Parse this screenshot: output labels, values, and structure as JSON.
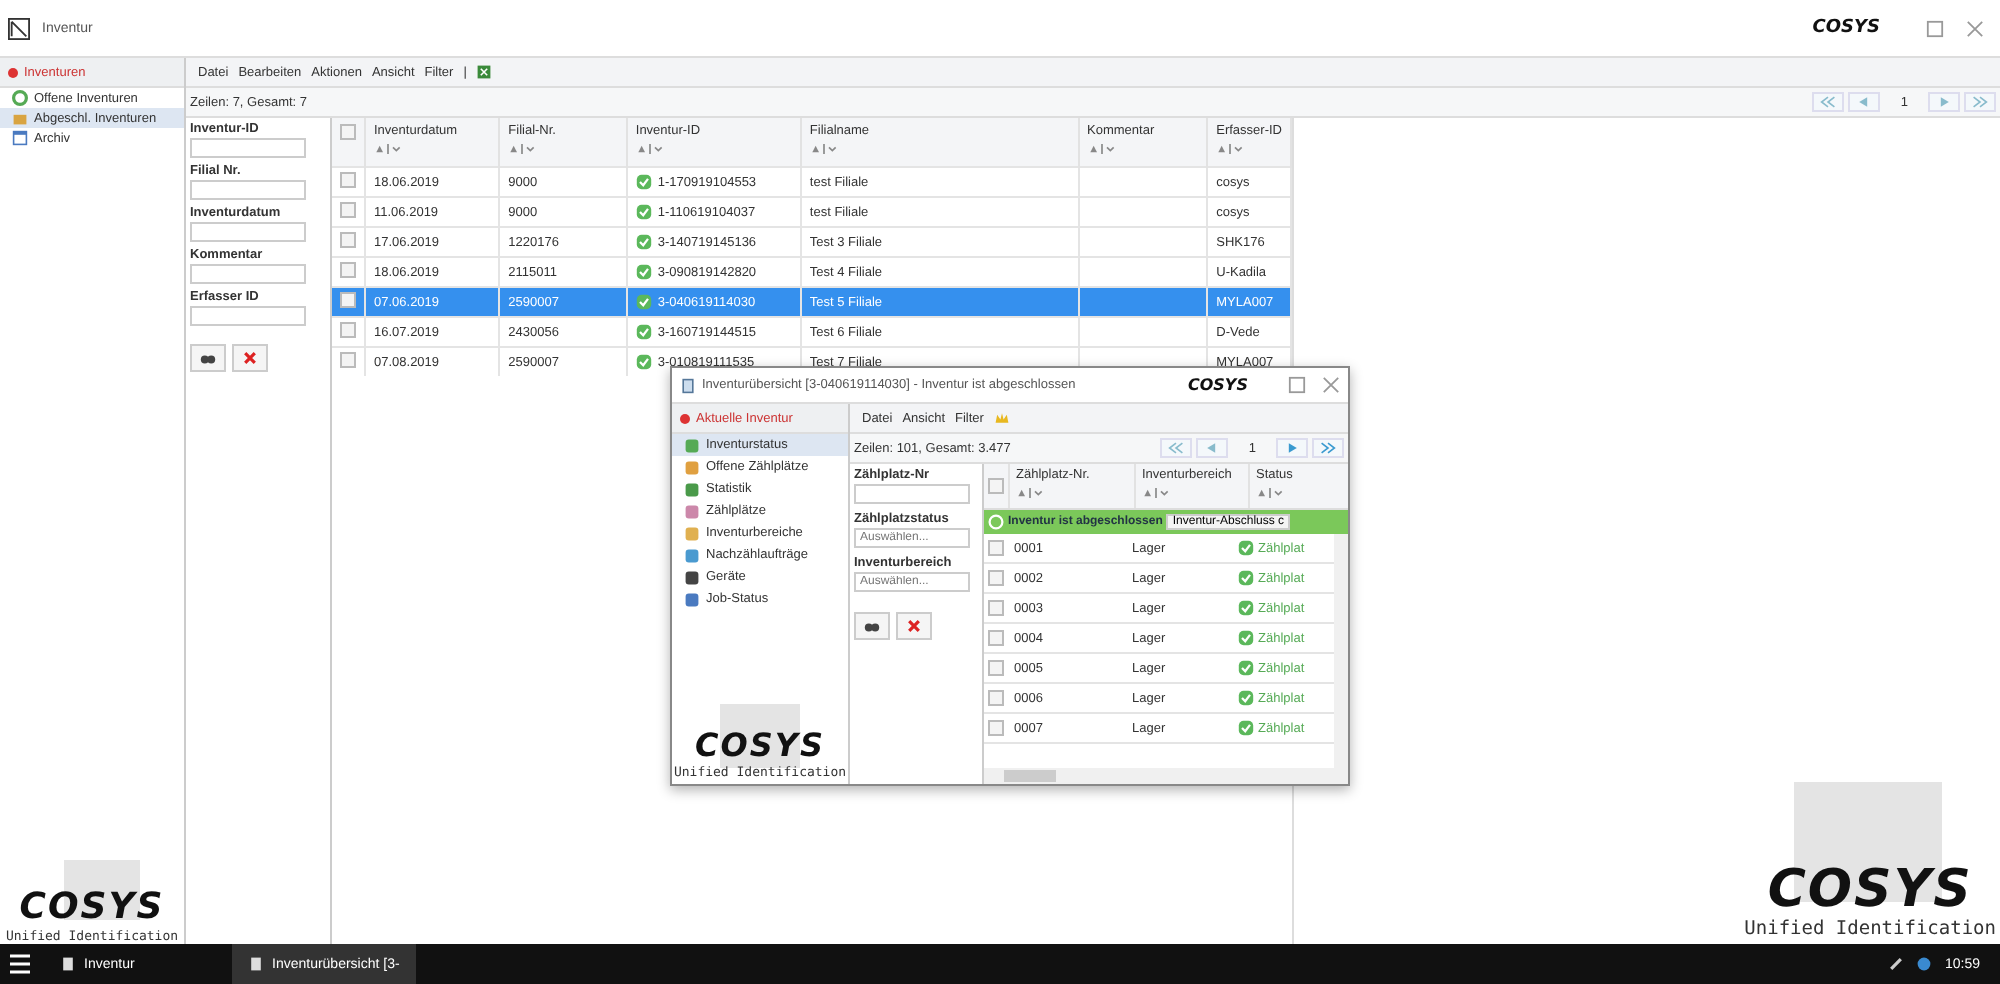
{
  "window": {
    "title": "Inventur",
    "logo": "COSYS"
  },
  "sidebar": {
    "header": "Inventuren",
    "items": [
      {
        "label": "Offene Inventuren",
        "selected": false
      },
      {
        "label": "Abgeschl. Inventuren",
        "selected": true
      },
      {
        "label": "Archiv",
        "selected": false
      }
    ]
  },
  "menu": [
    "Datei",
    "Bearbeiten",
    "Aktionen",
    "Ansicht",
    "Filter",
    "|"
  ],
  "count": "Zeilen: 7, Gesamt: 7",
  "pager": {
    "page": "1"
  },
  "filters": [
    {
      "label": "Inventur-ID"
    },
    {
      "label": "Filial Nr."
    },
    {
      "label": "Inventurdatum"
    },
    {
      "label": "Kommentar"
    },
    {
      "label": "Erfasser ID"
    }
  ],
  "table": {
    "columns": [
      "Inventurdatum",
      "Filial-Nr.",
      "Inventur-ID",
      "Filialname",
      "Kommentar",
      "Erfasser-ID"
    ],
    "header_checked": false,
    "rows": [
      {
        "cells": [
          "18.06.2019",
          "9000",
          "1-170919104553",
          "test Filiale",
          "",
          "cosys"
        ],
        "selected": false,
        "checked": false
      },
      {
        "cells": [
          "11.06.2019",
          "9000",
          "1-110619104037",
          "test Filiale",
          "",
          "cosys"
        ],
        "selected": false,
        "checked": false
      },
      {
        "cells": [
          "17.06.2019",
          "1220176",
          "3-140719145136",
          "Test 3 Filiale",
          "",
          "SHK176"
        ],
        "selected": false,
        "checked": false
      },
      {
        "cells": [
          "18.06.2019",
          "2115011",
          "3-090819142820",
          "Test 4 Filiale",
          "",
          "U-Kadila"
        ],
        "selected": false,
        "checked": false
      },
      {
        "cells": [
          "07.06.2019",
          "2590007",
          "3-040619114030",
          "Test 5 Filiale",
          "",
          "MYLA007"
        ],
        "selected": true,
        "checked": false
      },
      {
        "cells": [
          "16.07.2019",
          "2430056",
          "3-160719144515",
          "Test 6 Filiale",
          "",
          "D-Vede"
        ],
        "selected": false,
        "checked": false
      },
      {
        "cells": [
          "07.08.2019",
          "2590007",
          "3-010819111535",
          "Test 7 Filiale",
          "",
          "MYLA007"
        ],
        "selected": false,
        "checked": false
      }
    ]
  },
  "branding_left": {
    "logo": "COSYS",
    "tagline": "Unified Identification"
  },
  "branding_right": {
    "logo": "COSYS",
    "tagline": "Unified Identification"
  },
  "dialog": {
    "title": "Inventurübersicht [3-040619114030] - Inventur ist abgeschlossen",
    "logo": "COSYS",
    "sidebar": {
      "header": "Aktuelle Inventur",
      "items": [
        {
          "label": "Inventurstatus",
          "selected": true
        },
        {
          "label": "Offene Zählplätze",
          "selected": false
        },
        {
          "label": "Statistik",
          "selected": false
        },
        {
          "label": "Zählplätze",
          "selected": false
        },
        {
          "label": "Inventurbereiche",
          "selected": false
        },
        {
          "label": "Nachzählaufträge",
          "selected": false
        },
        {
          "label": "Geräte",
          "selected": false
        },
        {
          "label": "Job-Status",
          "selected": false
        }
      ]
    },
    "menu": [
      "Datei",
      "Ansicht",
      "Filter"
    ],
    "count": "Zeilen: 101, Gesamt: 3.477",
    "pager": {
      "page": "1"
    },
    "filters": [
      {
        "label": "Zählplatz-Nr",
        "kind": "input"
      },
      {
        "label": "Zählplatzstatus",
        "kind": "select",
        "placeholder": "Auswählen..."
      },
      {
        "label": "Inventurbereich",
        "kind": "select",
        "placeholder": "Auswählen..."
      }
    ],
    "table": {
      "columns": [
        "Zählplatz-Nr.",
        "Inventurbereich",
        "Status"
      ],
      "header_checked": false,
      "banner": "Inventur ist abgeschlossen",
      "banner_button": "Inventur-Abschluss c",
      "rows": [
        {
          "cells": [
            "0001",
            "Lager",
            "Zählplat"
          ],
          "checked": false
        },
        {
          "cells": [
            "0002",
            "Lager",
            "Zählplat"
          ],
          "checked": false
        },
        {
          "cells": [
            "0003",
            "Lager",
            "Zählplat"
          ],
          "checked": false
        },
        {
          "cells": [
            "0004",
            "Lager",
            "Zählplat"
          ],
          "checked": false
        },
        {
          "cells": [
            "0005",
            "Lager",
            "Zählplat"
          ],
          "checked": false
        },
        {
          "cells": [
            "0006",
            "Lager",
            "Zählplat"
          ],
          "checked": false
        },
        {
          "cells": [
            "0007",
            "Lager",
            "Zählplat"
          ],
          "checked": false
        }
      ]
    },
    "branding": {
      "logo": "COSYS",
      "tagline": "Unified Identification"
    }
  },
  "taskbar": {
    "items": [
      {
        "label": "Inventur",
        "selected": false
      },
      {
        "label": "Inventurübersicht [3-",
        "selected": true
      }
    ],
    "time": "10:59"
  }
}
